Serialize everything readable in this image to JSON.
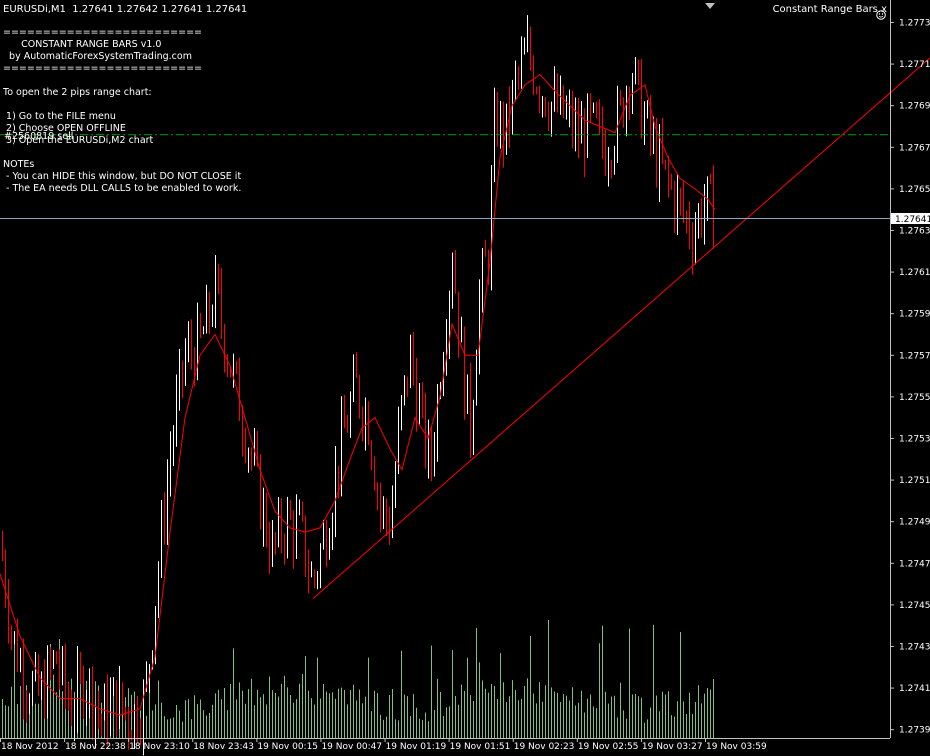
{
  "header": {
    "symbol": "EURUSDi,M1",
    "ohlc": "1.27641 1.27642 1.27641 1.27641",
    "indicator_name": "Constant Range Bars.x",
    "indicator_icon": "smiley-icon"
  },
  "info_panel": {
    "lines": [
      "=========================",
      "      CONSTANT RANGE BARS v1.0",
      "  by AutomaticForexSystemTrading.com",
      "=========================",
      "",
      "To open the 2 pips range chart:",
      "",
      " 1) Go to the FILE menu",
      " 2) Choose OPEN OFFLINE",
      " 3) Open the EURUSDi,M2 chart",
      "",
      "NOTEs",
      " - You can HIDE this window, but DO NOT CLOSE it",
      " - The EA needs DLL CALLS to be enabled to work."
    ],
    "overlay_label": "#2560819 sell"
  },
  "current_price_label": "1.27641",
  "colors": {
    "background": "#000000",
    "bull_candle": "#ffffff",
    "bear_candle": "#ff0000",
    "moving_average": "#ff0000",
    "trendline": "#ff0000",
    "volume": "#7fbf7f",
    "level_line": "#00a000",
    "price_line": "#8fa8c0"
  },
  "chart_data": {
    "type": "candlestick",
    "price_axis": {
      "ticks": [
        "1.27735",
        "1.27715",
        "1.27695",
        "1.27675",
        "1.27655",
        "1.27635",
        "1.27615",
        "1.27595",
        "1.27575",
        "1.27555",
        "1.27535",
        "1.27515",
        "1.27495",
        "1.27475",
        "1.27455",
        "1.27435",
        "1.27415",
        "1.27395"
      ],
      "range": [
        1.27391,
        1.27741
      ]
    },
    "time_axis": {
      "ticks": [
        "18 Nov 2012",
        "18 Nov 22:38",
        "18 Nov 23:10",
        "18 Nov 23:43",
        "19 Nov 00:15",
        "19 Nov 00:47",
        "19 Nov 01:19",
        "19 Nov 01:51",
        "19 Nov 02:23",
        "19 Nov 02:55",
        "19 Nov 03:27",
        "19 Nov 03:59"
      ]
    },
    "close_path": [
      [
        0,
        1.27485
      ],
      [
        12,
        1.2744
      ],
      [
        25,
        1.2742
      ],
      [
        40,
        1.2741
      ],
      [
        55,
        1.2743
      ],
      [
        70,
        1.27405
      ],
      [
        85,
        1.2742
      ],
      [
        100,
        1.274
      ],
      [
        115,
        1.2741
      ],
      [
        130,
        1.274
      ],
      [
        145,
        1.2741
      ],
      [
        155,
        1.2746
      ],
      [
        170,
        1.2753
      ],
      [
        185,
        1.27575
      ],
      [
        200,
        1.2758
      ],
      [
        215,
        1.27605
      ],
      [
        230,
        1.2757
      ],
      [
        245,
        1.2754
      ],
      [
        260,
        1.27505
      ],
      [
        272,
        1.2748
      ],
      [
        285,
        1.27495
      ],
      [
        300,
        1.2749
      ],
      [
        312,
        1.27465
      ],
      [
        325,
        1.2749
      ],
      [
        340,
        1.2753
      ],
      [
        355,
        1.2756
      ],
      [
        368,
        1.27545
      ],
      [
        380,
        1.275
      ],
      [
        390,
        1.27495
      ],
      [
        400,
        1.27545
      ],
      [
        410,
        1.27575
      ],
      [
        420,
        1.27545
      ],
      [
        430,
        1.2752
      ],
      [
        440,
        1.2757
      ],
      [
        452,
        1.27625
      ],
      [
        463,
        1.27565
      ],
      [
        470,
        1.2754
      ],
      [
        478,
        1.276
      ],
      [
        488,
        1.27625
      ],
      [
        495,
        1.2769
      ],
      [
        505,
        1.2768
      ],
      [
        515,
        1.27705
      ],
      [
        527,
        1.2772
      ],
      [
        540,
        1.27705
      ],
      [
        552,
        1.27695
      ],
      [
        565,
        1.2769
      ],
      [
        578,
        1.2768
      ],
      [
        590,
        1.27685
      ],
      [
        605,
        1.27675
      ],
      [
        620,
        1.2769
      ],
      [
        630,
        1.27715
      ],
      [
        640,
        1.27695
      ],
      [
        652,
        1.27675
      ],
      [
        665,
        1.2766
      ],
      [
        680,
        1.27645
      ],
      [
        692,
        1.27635
      ],
      [
        705,
        1.2765
      ],
      [
        713,
        1.27641
      ]
    ],
    "moving_average": [
      [
        0,
        1.2747
      ],
      [
        20,
        1.2744
      ],
      [
        40,
        1.2742
      ],
      [
        60,
        1.2741
      ],
      [
        80,
        1.2741
      ],
      [
        100,
        1.27405
      ],
      [
        120,
        1.27402
      ],
      [
        140,
        1.27405
      ],
      [
        155,
        1.2743
      ],
      [
        170,
        1.2749
      ],
      [
        185,
        1.27545
      ],
      [
        200,
        1.27575
      ],
      [
        215,
        1.27585
      ],
      [
        230,
        1.2757
      ],
      [
        245,
        1.27545
      ],
      [
        260,
        1.2752
      ],
      [
        275,
        1.275
      ],
      [
        290,
        1.27492
      ],
      [
        305,
        1.2749
      ],
      [
        320,
        1.27492
      ],
      [
        335,
        1.27505
      ],
      [
        350,
        1.27525
      ],
      [
        362,
        1.2754
      ],
      [
        375,
        1.27545
      ],
      [
        390,
        1.2753
      ],
      [
        402,
        1.2752
      ],
      [
        415,
        1.27545
      ],
      [
        428,
        1.27535
      ],
      [
        440,
        1.27555
      ],
      [
        452,
        1.2759
      ],
      [
        465,
        1.27575
      ],
      [
        478,
        1.27575
      ],
      [
        490,
        1.2762
      ],
      [
        500,
        1.2767
      ],
      [
        512,
        1.27695
      ],
      [
        525,
        1.27705
      ],
      [
        540,
        1.2771
      ],
      [
        555,
        1.27702
      ],
      [
        570,
        1.27695
      ],
      [
        585,
        1.27688
      ],
      [
        600,
        1.27685
      ],
      [
        615,
        1.27682
      ],
      [
        630,
        1.277
      ],
      [
        645,
        1.27705
      ],
      [
        655,
        1.27685
      ],
      [
        668,
        1.2767
      ],
      [
        680,
        1.2766
      ],
      [
        695,
        1.27655
      ],
      [
        708,
        1.2765
      ],
      [
        715,
        1.27645
      ]
    ],
    "trendline": {
      "from": [
        313,
        1.27458
      ],
      "to": [
        930,
        1.27718
      ]
    },
    "level_line": 1.27681,
    "current_price": 1.27641
  }
}
